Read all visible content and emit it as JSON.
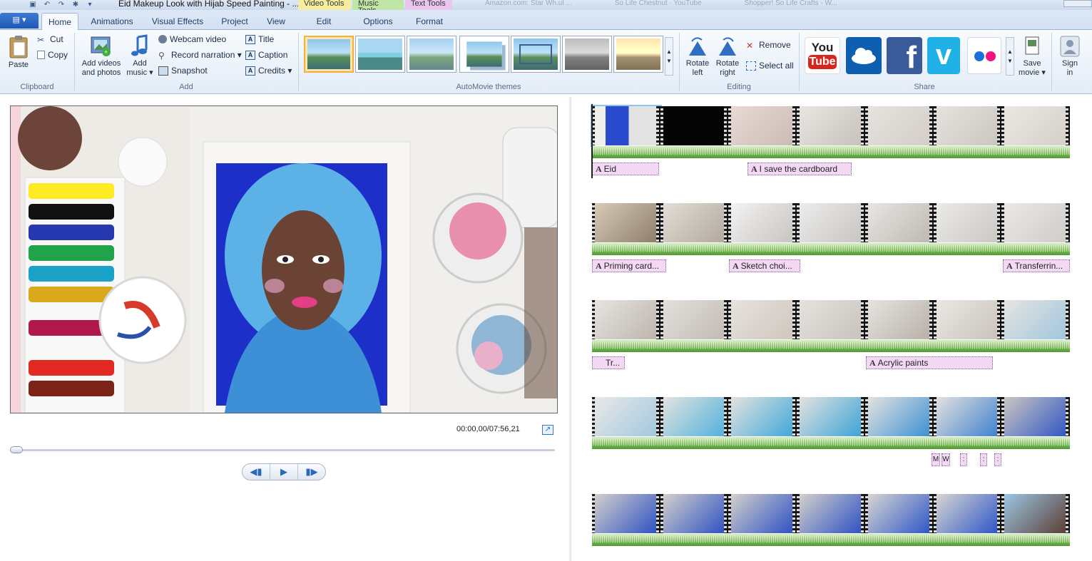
{
  "titlebar": {
    "title": "Eid Makeup Look with Hijab Speed Painting - ...",
    "contextual_tabs": [
      "Video Tools",
      "Music Tools",
      "Text Tools"
    ],
    "browser_tabs": [
      "Amazon.com: Star Wh.ul ...",
      "So Life Chestnut · YouTube",
      "Shopper! So Life Crafts - W..."
    ]
  },
  "ribbon_tabs": {
    "file": "▤ ▾",
    "tabs": [
      "Home",
      "Animations",
      "Visual Effects",
      "Project",
      "View",
      "Edit",
      "Options",
      "Format"
    ]
  },
  "clipboard": {
    "paste": "Paste",
    "cut": "Cut",
    "copy": "Copy",
    "label": "Clipboard"
  },
  "add": {
    "add_videos_l1": "Add videos",
    "add_videos_l2": "and photos",
    "add_music_l1": "Add",
    "add_music_l2": "music ▾",
    "webcam": "Webcam video",
    "narration": "Record narration ▾",
    "snapshot": "Snapshot",
    "title": "Title",
    "caption": "Caption",
    "credits": "Credits ▾",
    "label": "Add"
  },
  "themes": {
    "label": "AutoMovie themes",
    "count": 7
  },
  "editing": {
    "rotate_left_l1": "Rotate",
    "rotate_left_l2": "left",
    "rotate_right_l1": "Rotate",
    "rotate_right_l2": "right",
    "remove": "Remove",
    "select_all": "Select all",
    "label": "Editing"
  },
  "share": {
    "label": "Share",
    "youtube_l1": "You",
    "youtube_l2": "Tube",
    "facebook": "f",
    "vimeo": "v",
    "save_movie_l1": "Save",
    "save_movie_l2": "movie ▾",
    "sign_in_l1": "Sign",
    "sign_in_l2": "in"
  },
  "player": {
    "timecode": "00:00,00/07:56,21",
    "prev": "◀▮",
    "play": "▶",
    "next": "▮▶",
    "progress": 0
  },
  "storyboard": {
    "row1_captions": [
      "Eid",
      "I save the cardboard"
    ],
    "row2_captions": [
      "Priming card...",
      "Sketch choi...",
      "Transferrin..."
    ],
    "row3_captions": [
      "Tr...",
      "Acrylic paints"
    ],
    "row4_mini_captions": [
      "M",
      "W",
      ":",
      ":",
      ":"
    ]
  },
  "colors": {
    "accent": "#2b66c2",
    "caption_bg": "#f3d9f3",
    "audio": "#5aa83a"
  }
}
